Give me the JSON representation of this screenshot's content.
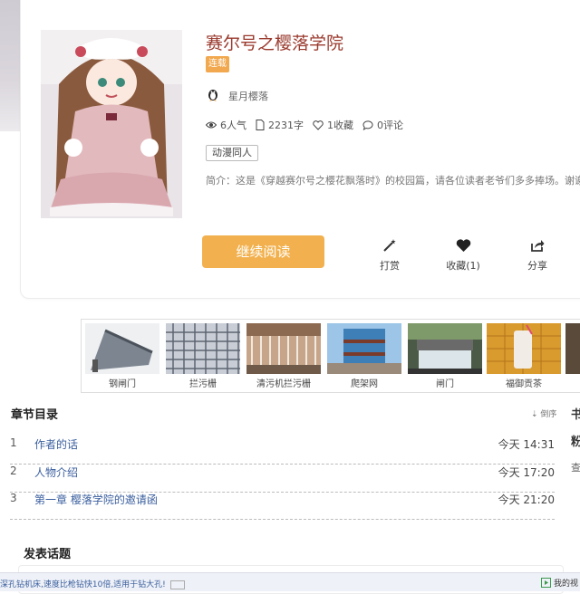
{
  "book": {
    "title": "赛尔号之樱落学院",
    "status_tag": "连载",
    "author": "星月樱落",
    "stats": {
      "popularity": "6人气",
      "words": "2231字",
      "favorites": "1收藏",
      "comments": "0评论"
    },
    "genre": "动漫同人",
    "intro": "简介：这是《穿越赛尔号之樱花飘落时》的校园篇，请各位读者老爷们多多捧场。谢谢！"
  },
  "actions": {
    "read_label": "继续阅读",
    "tip_label": "打赏",
    "favorite_label": "收藏(1)",
    "share_label": "分享"
  },
  "ads": [
    {
      "label": "钢闸门"
    },
    {
      "label": "拦污栅"
    },
    {
      "label": "清污机拦污栅"
    },
    {
      "label": "爬架网"
    },
    {
      "label": "闸门"
    },
    {
      "label": "福御贡茶"
    }
  ],
  "toc": {
    "title": "章节目录",
    "sort_label": "倒序",
    "chapters": [
      {
        "num": "1",
        "name": "作者的话",
        "time": "今天 14:31"
      },
      {
        "num": "2",
        "name": "人物介绍",
        "time": "今天 17:20"
      },
      {
        "num": "3",
        "name": "第一章 樱落学院的邀请函",
        "time": "今天 21:20"
      }
    ]
  },
  "side": {
    "line1": "书",
    "line2": "粉",
    "line3": "查"
  },
  "post": {
    "title": "发表话题"
  },
  "bottom": {
    "ad_text": "深孔钻机床,速度比枪钻快10倍,适用于钻大孔!",
    "right_text": "我的视"
  }
}
